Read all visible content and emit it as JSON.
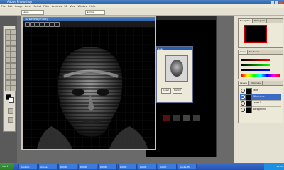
{
  "app": {
    "title": "Adobe Photoshop"
  },
  "menu": [
    "File",
    "Edit",
    "Image",
    "Layer",
    "Select",
    "Filter",
    "Analysis",
    "3D",
    "View",
    "Window",
    "Help"
  ],
  "options": {
    "field1": "Lasso",
    "field2": "Normal"
  },
  "view3d": {
    "title": "3D Window (Irrlicht)"
  },
  "dialog": {
    "title": "Load",
    "ok_label": "Load",
    "cancel_label": "Cancel"
  },
  "panels": {
    "navigator_tabs": [
      "Navigator",
      "Histogram"
    ],
    "color_tabs": [
      "Color",
      "Swatches"
    ],
    "layers_tabs": [
      "Layers",
      "Channels"
    ],
    "layers": [
      {
        "name": "Face"
      },
      {
        "name": "Wireframe"
      },
      {
        "name": "Layer 1"
      },
      {
        "name": "Background"
      }
    ]
  },
  "taskbar": {
    "start_label": "start",
    "items": [
      "Desktop",
      "Adobe",
      "DAVID",
      "DAVID",
      "DAVID",
      "DAVID",
      "DAVID",
      "DAVID",
      "Adobe Ph"
    ],
    "clock": "12:00"
  },
  "colors": {
    "accent": "#2f5fa8",
    "workspace": "#6a6a6a",
    "selected_layer": "#3b6bc4"
  }
}
